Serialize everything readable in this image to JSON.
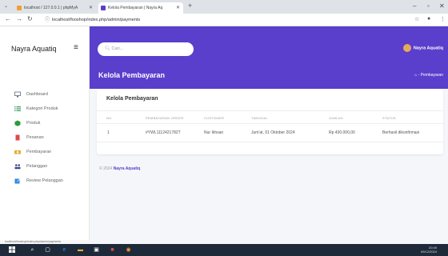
{
  "browser": {
    "tabs": [
      {
        "label": "localhost / 127.0.0.1 | phpMyA"
      },
      {
        "label": "Kelola Pembayaran | Nayra Aq"
      }
    ],
    "url": "localhost/fooshop/index.php/admin/payments"
  },
  "sidebar": {
    "brand": "Nayra Aquatiq",
    "items": [
      {
        "label": "Dashboard",
        "icon": "monitor-icon",
        "color": "#5b6b7b"
      },
      {
        "label": "Kategori Produk",
        "icon": "list-icon",
        "color": "#3a9b5c"
      },
      {
        "label": "Produk",
        "icon": "box-icon",
        "color": "#2e9a3e"
      },
      {
        "label": "Pesanan",
        "icon": "document-icon",
        "color": "#e04a4a"
      },
      {
        "label": "Pembayaran",
        "icon": "money-icon",
        "color": "#e0b030"
      },
      {
        "label": "Pelanggan",
        "icon": "users-icon",
        "color": "#3a4a8a"
      },
      {
        "label": "Review Pelanggan",
        "icon": "edit-icon",
        "color": "#2a8adf"
      }
    ],
    "status_url": "localhost/fooshop/index.php/admin/payments"
  },
  "topnav": {
    "search_placeholder": "Cari...",
    "user_name": "Nayra Aquatiq"
  },
  "page": {
    "title": "Kelola Pembayaran",
    "breadcrumb": "Pembayaran"
  },
  "card": {
    "title": "Kelola Pembayaran",
    "columns": [
      "NO",
      "PEMBAYARAN ORDER",
      "CUSTOMER",
      "TANGGAL",
      "JUMLAH",
      "STATUS"
    ],
    "rows": [
      [
        "1",
        "#YWL1112421782T",
        "Nur Ikhsan",
        "Jum'at, 01 Oktober 2024",
        "Rp 430.000,00",
        "Berhasil dikonfirmasi"
      ]
    ]
  },
  "footer": {
    "copyright": "© 2024",
    "brand": "Nayra Aquatiq"
  },
  "taskbar": {
    "time": "20:49",
    "date": "09/12/2024"
  },
  "colors": {
    "accent": "#5a3ecc"
  }
}
